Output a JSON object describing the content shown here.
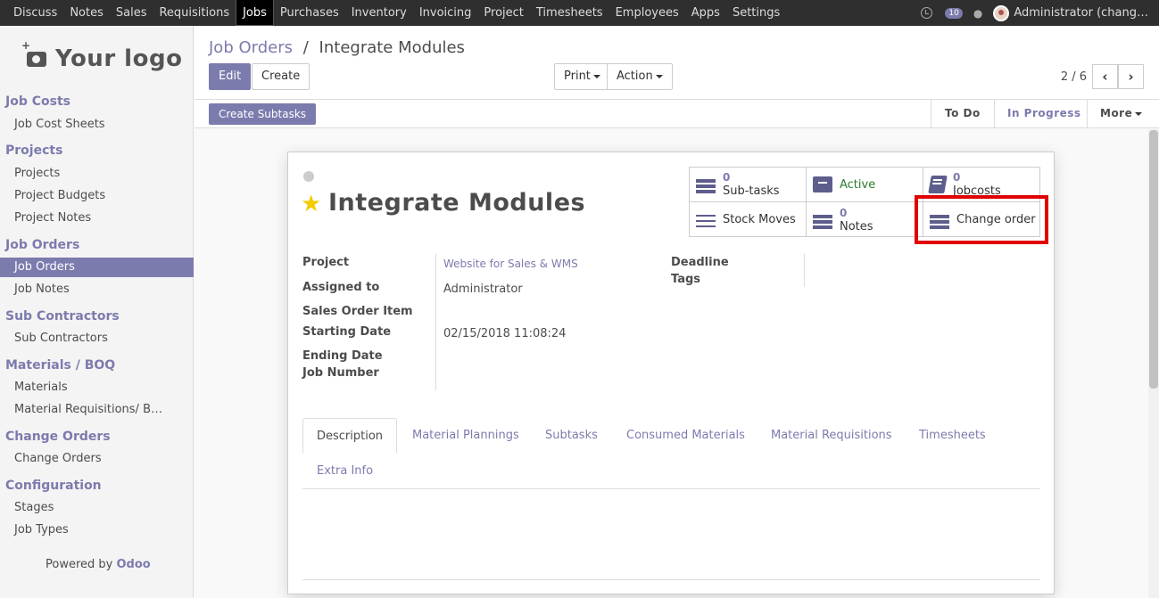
{
  "topbar": {
    "menu": [
      "Discuss",
      "Notes",
      "Sales",
      "Requisitions",
      "Jobs",
      "Purchases",
      "Inventory",
      "Invoicing",
      "Project",
      "Timesheets",
      "Employees",
      "Apps",
      "Settings"
    ],
    "active_menu": "Jobs",
    "chat_count": "10",
    "user": "Administrator (chang…"
  },
  "sidebar": {
    "logo": "Your logo",
    "sections": {
      "job_costs": "Job Costs",
      "projects": "Projects",
      "job_orders": "Job Orders",
      "sub_contractors": "Sub Contractors",
      "materials": "Materials / BOQ",
      "change_orders": "Change Orders",
      "configuration": "Configuration"
    },
    "items": {
      "job_cost_sheets": "Job Cost Sheets",
      "projects": "Projects",
      "project_budgets": "Project Budgets",
      "project_notes": "Project Notes",
      "job_orders": "Job Orders",
      "job_notes": "Job Notes",
      "sub_contractors": "Sub Contractors",
      "materials": "Materials",
      "material_requisitions": "Material Requisitions/ B…",
      "change_orders": "Change Orders",
      "stages": "Stages",
      "job_types": "Job Types"
    },
    "powered_by": "Powered by",
    "odoo": "Odoo"
  },
  "control": {
    "breadcrumb_parent": "Job Orders",
    "breadcrumb_sep": "/",
    "breadcrumb_current": "Integrate Modules",
    "edit": "Edit",
    "create": "Create",
    "print": "Print",
    "action": "Action",
    "pager": "2 / 6"
  },
  "statusbar": {
    "create_subtasks": "Create Subtasks",
    "todo": "To Do",
    "in_progress": "In Progress",
    "more": "More"
  },
  "record": {
    "title": "Integrate Modules",
    "smart": {
      "subtasks_count": "0",
      "subtasks_label": "Sub-tasks",
      "active_label": "Active",
      "jobcosts_count": "0",
      "jobcosts_label": "Jobcosts",
      "stock_moves_label": "Stock Moves",
      "notes_count": "0",
      "notes_label": "Notes",
      "change_order_label": "Change order"
    },
    "fields": {
      "project_label": "Project",
      "project_value": "Website for Sales & WMS",
      "assigned_label": "Assigned to",
      "assigned_value": "Administrator",
      "sale_item_label": "Sales Order Item",
      "start_label": "Starting Date",
      "start_value": "02/15/2018 11:08:24",
      "end_label": "Ending Date",
      "job_number_label": "Job Number",
      "deadline_label": "Deadline",
      "tags_label": "Tags"
    },
    "tabs": [
      "Description",
      "Material Plannings",
      "Subtasks",
      "Consumed Materials",
      "Material Requisitions",
      "Timesheets",
      "Extra Info"
    ]
  },
  "colors": {
    "brand": "#7c7bad",
    "highlight": "#e00000",
    "topbar": "#2f2f2f"
  }
}
